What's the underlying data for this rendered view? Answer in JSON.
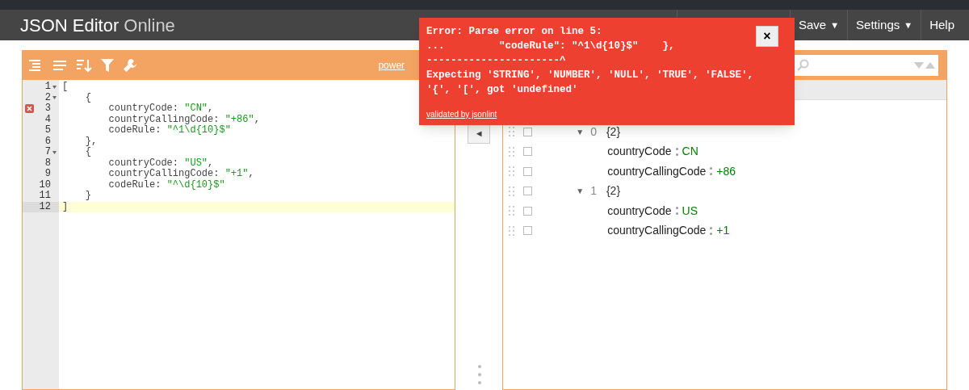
{
  "app": {
    "title": "JSON Editor",
    "subtitle": "Online"
  },
  "menu": [
    {
      "label": "Save",
      "dropdown": true
    },
    {
      "label": "Settings",
      "dropdown": true
    },
    {
      "label": "Help",
      "dropdown": false
    }
  ],
  "dropdown_glyph": "▼",
  "code_panel": {
    "powered_link": "power",
    "lines": [
      {
        "number": "1",
        "foldable": true,
        "error": false,
        "active": false,
        "segments": [
          {
            "kind": "plain",
            "text": "["
          }
        ]
      },
      {
        "number": "2",
        "foldable": true,
        "error": false,
        "active": false,
        "segments": [
          {
            "kind": "plain",
            "text": "    {"
          }
        ]
      },
      {
        "number": "3",
        "foldable": false,
        "error": true,
        "active": false,
        "segments": [
          {
            "kind": "plain",
            "text": "        countryCode: "
          },
          {
            "kind": "string",
            "text": "\"CN\""
          },
          {
            "kind": "plain",
            "text": ","
          }
        ]
      },
      {
        "number": "4",
        "foldable": false,
        "error": false,
        "active": false,
        "segments": [
          {
            "kind": "plain",
            "text": "        countryCallingCode: "
          },
          {
            "kind": "string",
            "text": "\"+86\""
          },
          {
            "kind": "plain",
            "text": ","
          }
        ]
      },
      {
        "number": "5",
        "foldable": false,
        "error": false,
        "active": false,
        "segments": [
          {
            "kind": "plain",
            "text": "        codeRule: "
          },
          {
            "kind": "string",
            "text": "\"^1\\d{10}$\""
          }
        ]
      },
      {
        "number": "6",
        "foldable": false,
        "error": false,
        "active": false,
        "segments": [
          {
            "kind": "plain",
            "text": "    },"
          }
        ]
      },
      {
        "number": "7",
        "foldable": true,
        "error": false,
        "active": false,
        "segments": [
          {
            "kind": "plain",
            "text": "    {"
          }
        ]
      },
      {
        "number": "8",
        "foldable": false,
        "error": false,
        "active": false,
        "segments": [
          {
            "kind": "plain",
            "text": "        countryCode: "
          },
          {
            "kind": "string",
            "text": "\"US\""
          },
          {
            "kind": "plain",
            "text": ","
          }
        ]
      },
      {
        "number": "9",
        "foldable": false,
        "error": false,
        "active": false,
        "segments": [
          {
            "kind": "plain",
            "text": "        countryCallingCode: "
          },
          {
            "kind": "string",
            "text": "\"+1\""
          },
          {
            "kind": "plain",
            "text": ","
          }
        ]
      },
      {
        "number": "10",
        "foldable": false,
        "error": false,
        "active": false,
        "segments": [
          {
            "kind": "plain",
            "text": "        codeRule: "
          },
          {
            "kind": "string",
            "text": "\"^\\d{10}$\""
          }
        ]
      },
      {
        "number": "11",
        "foldable": false,
        "error": false,
        "active": false,
        "segments": [
          {
            "kind": "plain",
            "text": "    }"
          }
        ]
      },
      {
        "number": "12",
        "foldable": false,
        "error": false,
        "active": true,
        "segments": [
          {
            "kind": "plain",
            "text": "]"
          }
        ]
      }
    ]
  },
  "copy_button": {
    "glyph": "◄"
  },
  "tree_panel": {
    "toggle_glyph": "▼",
    "nodes": [
      {
        "index": "0",
        "summary": "{2}",
        "expanded": true,
        "children": [
          {
            "key": "countryCode",
            "value": "CN"
          },
          {
            "key": "countryCallingCode",
            "value": "+86"
          }
        ]
      },
      {
        "index": "1",
        "summary": "{2}",
        "expanded": true,
        "children": [
          {
            "key": "countryCode",
            "value": "US"
          },
          {
            "key": "countryCallingCode",
            "value": "+1"
          }
        ]
      }
    ]
  },
  "error_popup": {
    "lines": [
      "Error: Parse error on line 5:",
      "...         \"codeRule\": \"^1\\d{10}$\"    },",
      "----------------------^",
      "Expecting 'STRING', 'NUMBER', 'NULL', 'TRUE', 'FALSE', '{', '[', got 'undefined'"
    ],
    "link": "validated by jsonlint",
    "close": "×"
  }
}
